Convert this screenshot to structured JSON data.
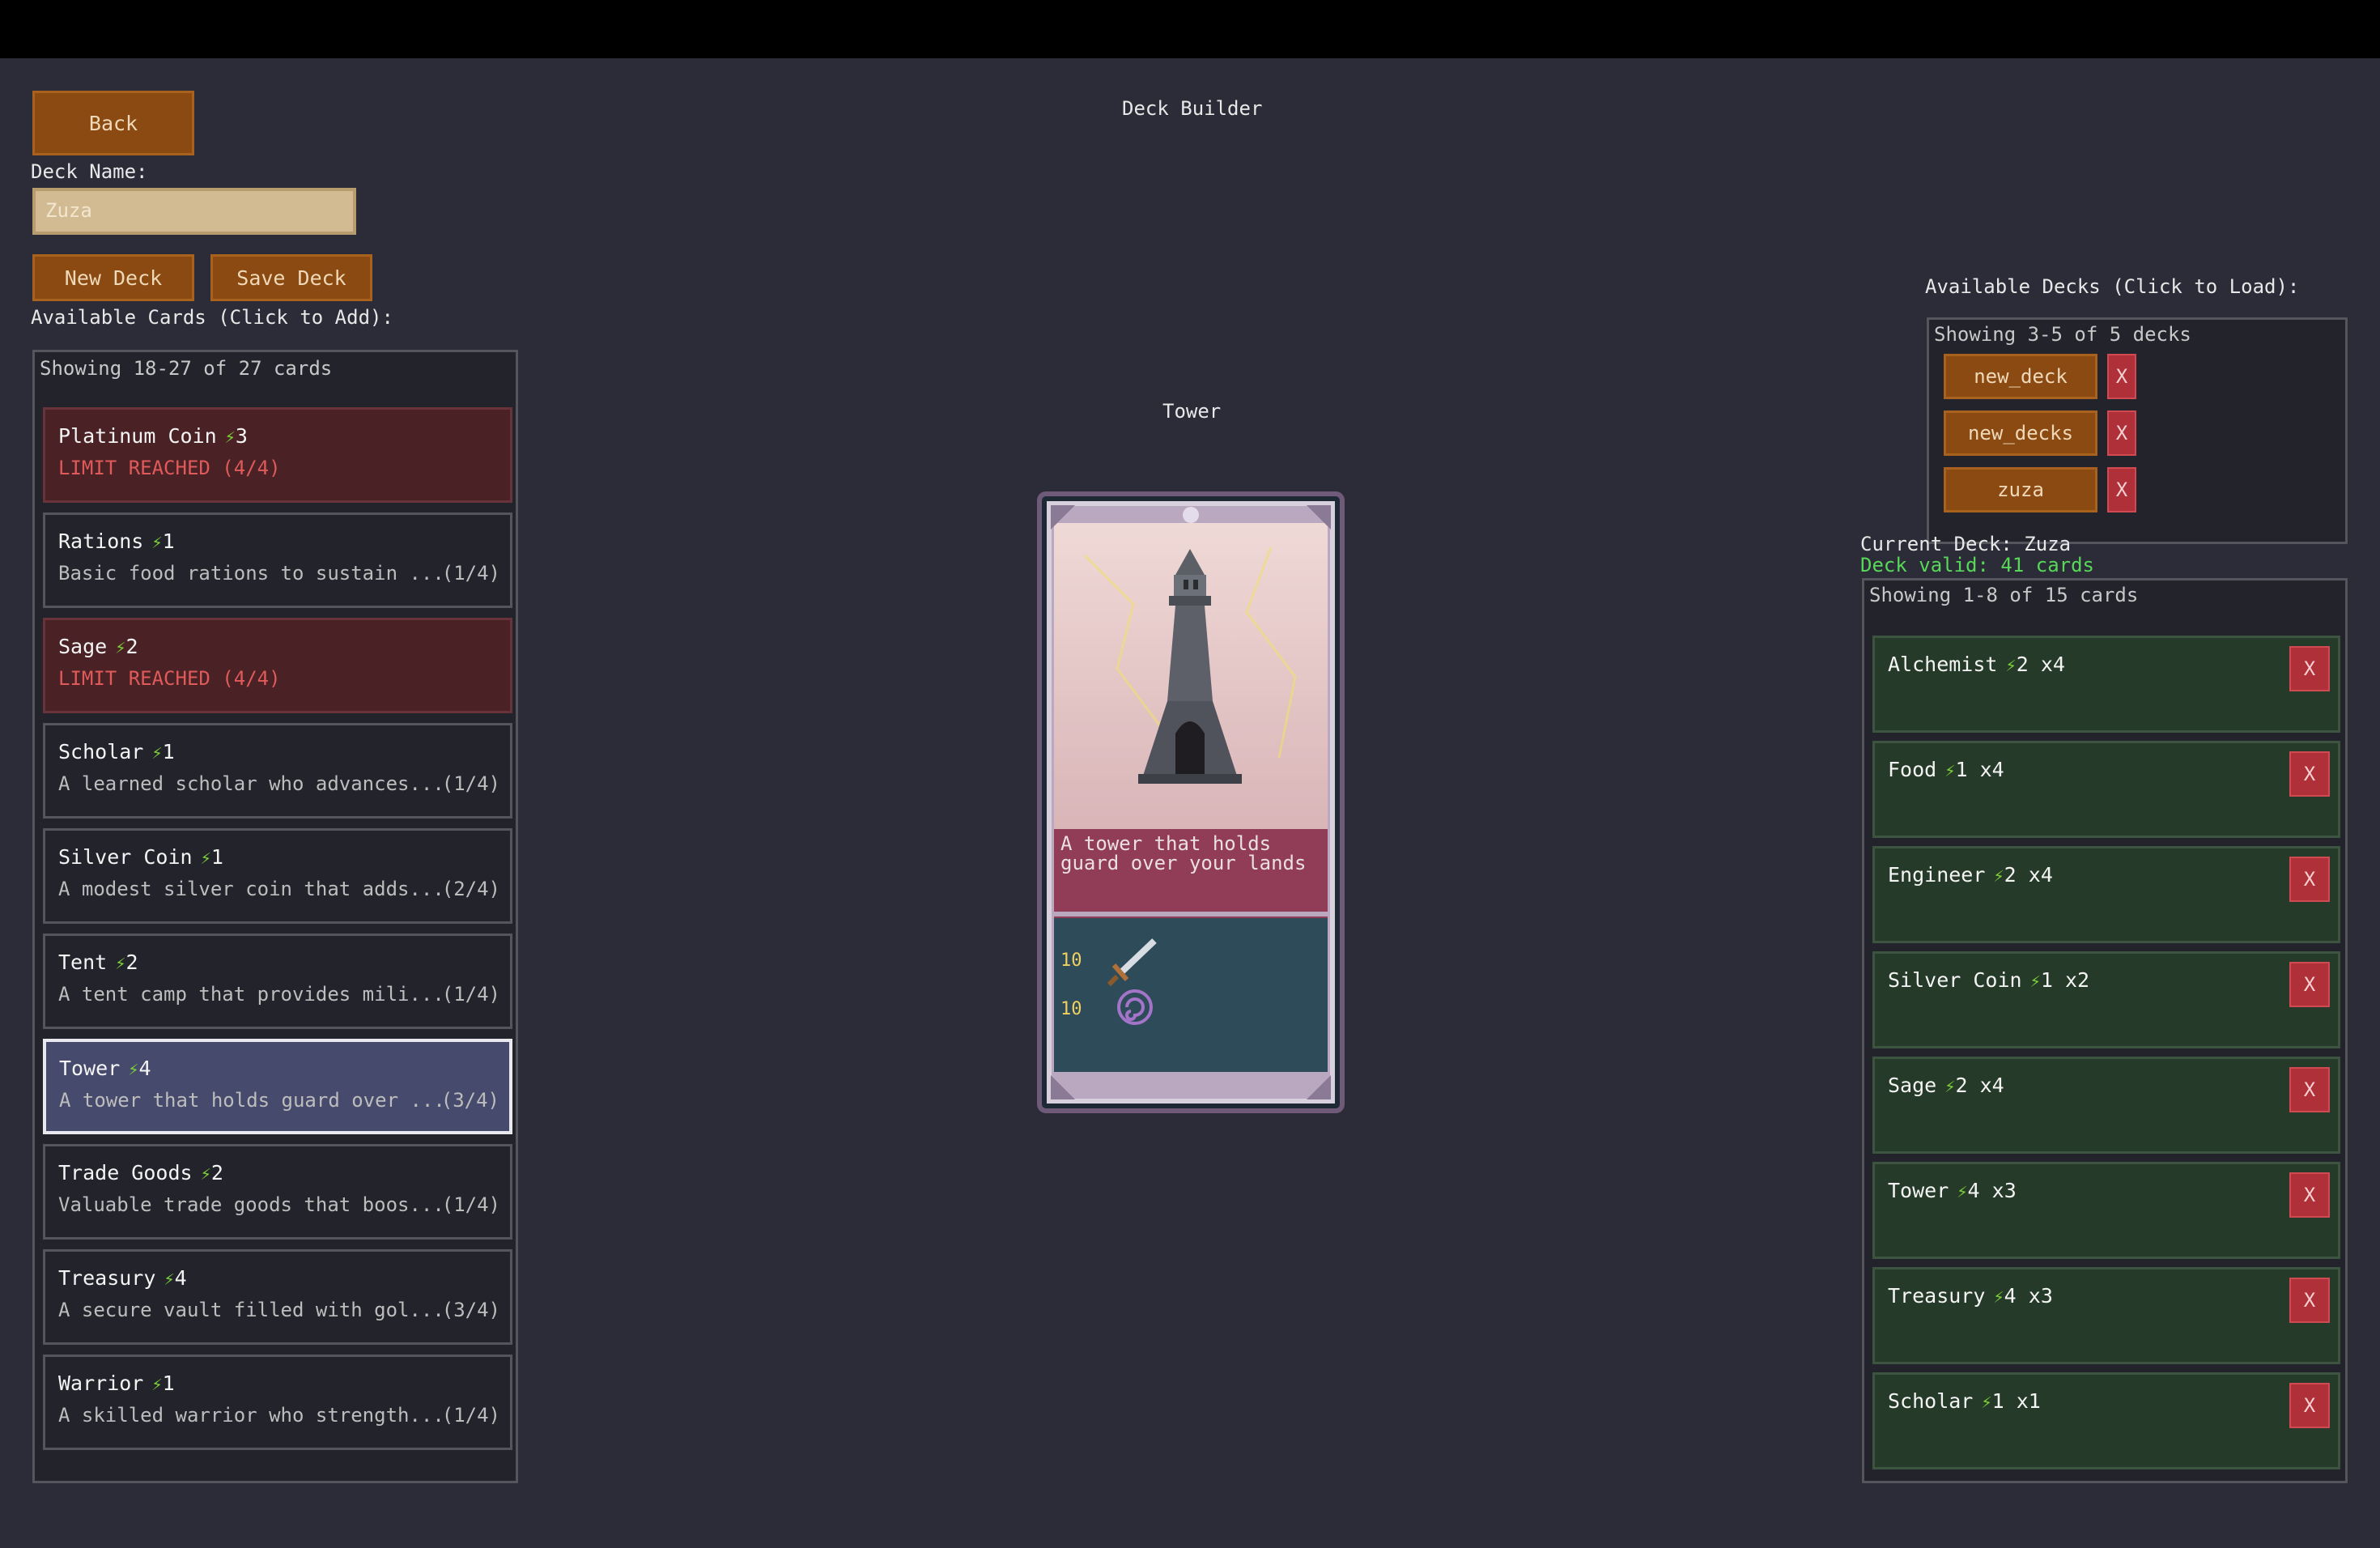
{
  "header": {
    "title": "Deck Builder"
  },
  "toolbar": {
    "back_label": "Back",
    "new_deck_label": "New Deck",
    "save_deck_label": "Save Deck"
  },
  "deck_name": {
    "label": "Deck Name:",
    "placeholder": "Zuza"
  },
  "available_cards": {
    "heading": "Available Cards (Click to Add):",
    "showing": "Showing 18-27 of 27 cards",
    "items": [
      {
        "name": "Platinum Coin",
        "cost": "3",
        "desc": "LIMIT REACHED (4/4)",
        "count": ""
      },
      {
        "name": "Rations",
        "cost": "1",
        "desc": "Basic food rations to sustain ...",
        "count": "(1/4)"
      },
      {
        "name": "Sage",
        "cost": "2",
        "desc": "LIMIT REACHED (4/4)",
        "count": ""
      },
      {
        "name": "Scholar",
        "cost": "1",
        "desc": "A learned scholar who advances...",
        "count": "(1/4)"
      },
      {
        "name": "Silver Coin",
        "cost": "1",
        "desc": "A modest silver coin that adds...",
        "count": "(2/4)"
      },
      {
        "name": "Tent",
        "cost": "2",
        "desc": "A tent camp that provides mili...",
        "count": "(1/4)"
      },
      {
        "name": "Tower",
        "cost": "4",
        "desc": "A tower that holds guard over ...",
        "count": "(3/4)"
      },
      {
        "name": "Trade Goods",
        "cost": "2",
        "desc": "Valuable trade goods that boos...",
        "count": "(1/4)"
      },
      {
        "name": "Treasury",
        "cost": "4",
        "desc": "A secure vault filled with gol...",
        "count": "(3/4)"
      },
      {
        "name": "Warrior",
        "cost": "1",
        "desc": "A skilled warrior who strength...",
        "count": "(1/4)"
      }
    ]
  },
  "preview": {
    "title": "Tower",
    "desc_line1": "A tower that holds",
    "desc_line2": "guard over your lands",
    "attack": "10",
    "magic": "10"
  },
  "available_decks": {
    "heading": "Available Decks (Click to Load):",
    "showing": "Showing 3-5 of 5 decks",
    "items": [
      {
        "name": "new_deck",
        "delete": "X"
      },
      {
        "name": "new_decks",
        "delete": "X"
      },
      {
        "name": "zuza",
        "delete": "X"
      }
    ]
  },
  "current_deck": {
    "label": "Current Deck: Zuza",
    "status": "Deck valid: 41 cards",
    "status_color": "#58d858",
    "showing": "Showing 1-8 of 15 cards",
    "items": [
      {
        "name": "Alchemist",
        "cost": "2",
        "qty": "x4",
        "remove": "X"
      },
      {
        "name": "Food",
        "cost": "1",
        "qty": "x4",
        "remove": "X"
      },
      {
        "name": "Engineer",
        "cost": "2",
        "qty": "x4",
        "remove": "X"
      },
      {
        "name": "Silver Coin",
        "cost": "1",
        "qty": "x2",
        "remove": "X"
      },
      {
        "name": "Sage",
        "cost": "2",
        "qty": "x4",
        "remove": "X"
      },
      {
        "name": "Tower",
        "cost": "4",
        "qty": "x3",
        "remove": "X"
      },
      {
        "name": "Treasury",
        "cost": "4",
        "qty": "x3",
        "remove": "X"
      },
      {
        "name": "Scholar",
        "cost": "1",
        "qty": "x1",
        "remove": "X"
      }
    ]
  },
  "colors": {
    "background": "#2b2c37",
    "button": "#8a4a12",
    "limit": "#4a2226",
    "deck_card": "#253a28",
    "delete": "#b0303a",
    "energy": "#7cd038"
  },
  "icons": {
    "energy": "lightning-bolt-icon",
    "attack": "sword-icon",
    "magic": "spiral-icon"
  }
}
